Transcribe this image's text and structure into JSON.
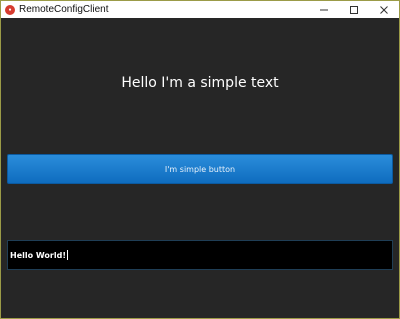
{
  "window": {
    "title": "RemoteConfigClient",
    "icon": "app-logo-icon",
    "controls": [
      "minimize-icon",
      "maximize-icon",
      "close-icon"
    ]
  },
  "main": {
    "text_label": "Hello I'm a simple text",
    "button_label": "I'm simple button",
    "input_value": "Hello World!"
  },
  "colors": {
    "background": "#262626",
    "button": "#1a7bd0",
    "input_background": "#000000",
    "text": "#ffffff"
  }
}
